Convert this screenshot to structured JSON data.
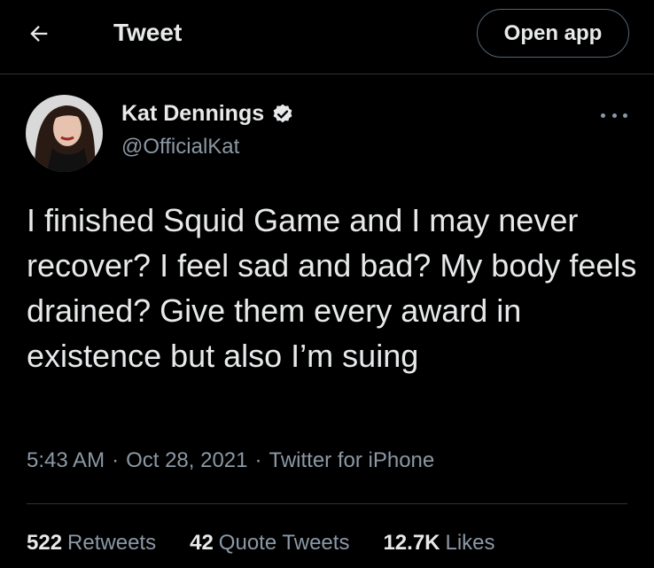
{
  "header": {
    "title": "Tweet",
    "open_app_label": "Open app",
    "back_icon": "arrow-left-icon"
  },
  "author": {
    "name": "Kat Dennings",
    "handle": "@OfficialKat",
    "verified": true,
    "verified_icon": "verified-badge-icon"
  },
  "tweet": {
    "text": "I finished Squid Game and I may never recover? I feel sad and bad? My body feels drained? Give them every award in existence but also I’m suing",
    "time": "5:43 AM",
    "date": "Oct 28, 2021",
    "source": "Twitter for iPhone",
    "separator": "·"
  },
  "stats": {
    "retweets_count": "522",
    "retweets_label": "Retweets",
    "quotes_count": "42",
    "quotes_label": "Quote Tweets",
    "likes_count": "12.7K",
    "likes_label": "Likes"
  },
  "colors": {
    "background": "#000000",
    "text_primary": "#e7e9ea",
    "text_secondary": "#8b98a5",
    "border": "#2f3336"
  }
}
